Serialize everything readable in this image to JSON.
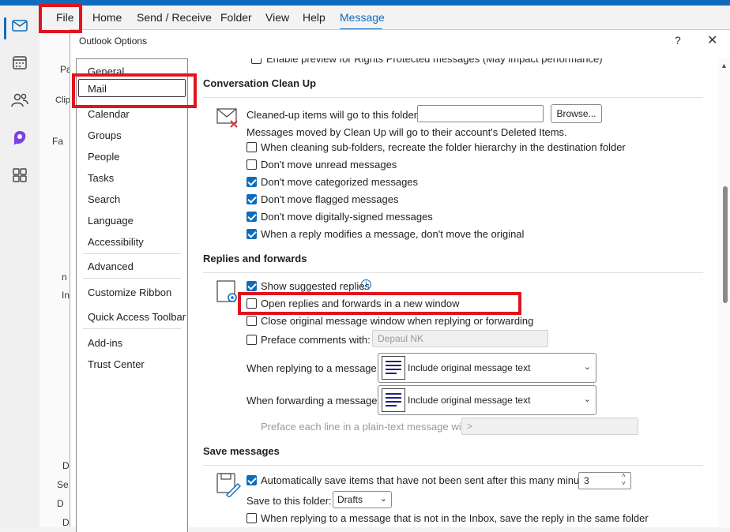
{
  "ribbon": {
    "tabs": [
      "File",
      "Home",
      "Send / Receive",
      "Folder",
      "View",
      "Help",
      "Message"
    ],
    "active_tab": "Message"
  },
  "background": {
    "clip_text": "Pa",
    "clip_label": "Clip",
    "fav_label": "Fa",
    "n_label": "n",
    "in_label": "In",
    "d1": "D",
    "se": "Se",
    "d2": "D",
    "d3": "D"
  },
  "dialog": {
    "title": "Outlook Options",
    "help": "?",
    "close": "✕"
  },
  "nav": {
    "items": [
      "General",
      "Mail",
      "Calendar",
      "Groups",
      "People",
      "Tasks",
      "Search",
      "Language",
      "Accessibility",
      "Advanced",
      "Customize Ribbon",
      "Quick Access Toolbar",
      "Add-ins",
      "Trust Center"
    ],
    "selected": "Mail"
  },
  "content": {
    "top_partial": "Enable preview for Rights Protected messages (May impact performance)",
    "cleanup": {
      "title": "Conversation Clean Up",
      "folder_label": "Cleaned-up items will go to this folder:",
      "folder_value": "",
      "browse_label": "Browse...",
      "note": "Messages moved by Clean Up will go to their account's Deleted Items.",
      "options": [
        {
          "label": "When cleaning sub-folders, recreate the folder hierarchy in the destination folder",
          "checked": false
        },
        {
          "label": "Don't move unread messages",
          "checked": false
        },
        {
          "label": "Don't move categorized messages",
          "checked": true
        },
        {
          "label": "Don't move flagged messages",
          "checked": true
        },
        {
          "label": "Don't move digitally-signed messages",
          "checked": true
        },
        {
          "label": "When a reply modifies a message, don't move the original",
          "checked": true
        }
      ]
    },
    "replies": {
      "title": "Replies and forwards",
      "options": [
        {
          "label": "Show suggested replies",
          "checked": true
        },
        {
          "label": "Open replies and forwards in a new window",
          "checked": false
        },
        {
          "label": "Close original message window when replying or forwarding",
          "checked": false
        },
        {
          "label": "Preface comments with:",
          "checked": false
        }
      ],
      "preface_value": "Depaul NK",
      "info_icon": "i",
      "reply_label": "When replying to a message:",
      "reply_value": "Include original message text",
      "forward_label": "When forwarding a message:",
      "forward_value": "Include original message text",
      "plaintext_label": "Preface each line in a plain-text message with:",
      "plaintext_value": ">"
    },
    "save": {
      "title": "Save messages",
      "autosave_label": "Automatically save items that have not been sent after this many minutes:",
      "autosave_checked": true,
      "minutes": "3",
      "folder_label": "Save to this folder:",
      "folder_value": "Drafts",
      "inbox_label": "When replying to a message that is not in the Inbox, save the reply in the same folder",
      "inbox_checked": false
    }
  },
  "colors": {
    "accent": "#0f6cbd",
    "highlight": "#e0141e"
  }
}
